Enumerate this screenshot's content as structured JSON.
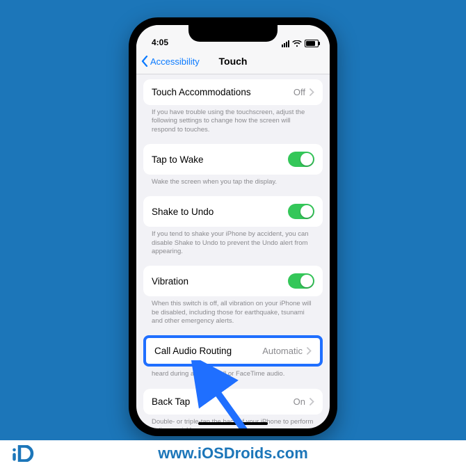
{
  "statusbar": {
    "time": "4:05"
  },
  "nav": {
    "back_label": "Accessibility",
    "title": "Touch"
  },
  "rows": {
    "touch_accom": {
      "label": "Touch Accommodations",
      "value": "Off",
      "footer": "If you have trouble using the touchscreen, adjust the following settings to change how the screen will respond to touches."
    },
    "tap_wake": {
      "label": "Tap to Wake",
      "footer": "Wake the screen when you tap the display."
    },
    "shake_undo": {
      "label": "Shake to Undo",
      "footer": "If you tend to shake your iPhone by accident, you can disable Shake to Undo to prevent the Undo alert from appearing."
    },
    "vibration": {
      "label": "Vibration",
      "footer": "When this switch is off, all vibration on your iPhone will be disabled, including those for earthquake, tsunami and other emergency alerts."
    },
    "call_audio": {
      "label": "Call Audio Routing",
      "value": "Automatic",
      "footer": "heard during a phone call or FaceTime audio."
    },
    "back_tap": {
      "label": "Back Tap",
      "value": "On",
      "footer": "Double- or triple-tap the back of your iPhone to perform actions quickly."
    }
  },
  "brand": {
    "url": "www.iOSDroids.com",
    "logo_text": "iD"
  }
}
